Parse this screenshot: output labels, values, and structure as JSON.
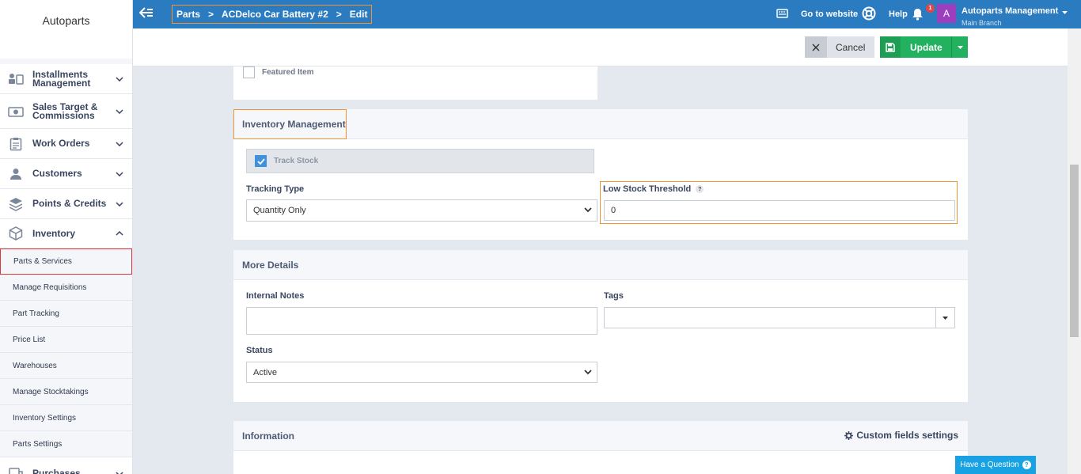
{
  "app": {
    "brand": "Autoparts"
  },
  "breadcrumb": [
    "Parts",
    "ACDelco Car Battery #2",
    "Edit"
  ],
  "topbar": {
    "go_to_website": "Go to website",
    "help": "Help",
    "notification_count": "1",
    "avatar_letter": "A",
    "account_name": "Autoparts Management",
    "account_branch": "Main Branch"
  },
  "actions": {
    "cancel": "Cancel",
    "update": "Update"
  },
  "sidebar": {
    "items": [
      {
        "label": "Installments Management",
        "icon": "installments-icon"
      },
      {
        "label": "Sales Target & Commissions",
        "icon": "commissions-icon"
      },
      {
        "label": "Work Orders",
        "icon": "clipboard-icon"
      },
      {
        "label": "Customers",
        "icon": "user-icon"
      },
      {
        "label": "Points & Credits",
        "icon": "layers-icon"
      },
      {
        "label": "Inventory",
        "icon": "box-icon"
      },
      {
        "label": "Purchases",
        "icon": "purchases-icon"
      }
    ],
    "inventory_sub": [
      "Parts & Services",
      "Manage Requisitions",
      "Part Tracking",
      "Price List",
      "Warehouses",
      "Manage Stocktakings",
      "Inventory Settings",
      "Parts Settings"
    ]
  },
  "featured": {
    "label": "Featured Item",
    "checked": false
  },
  "inventory": {
    "title": "Inventory Management",
    "track_stock_label": "Track Stock",
    "track_stock_checked": true,
    "tracking_type_label": "Tracking Type",
    "tracking_type_value": "Quantity Only",
    "low_stock_label": "Low Stock Threshold",
    "low_stock_value": "0"
  },
  "more_details": {
    "title": "More Details",
    "internal_notes_label": "Internal Notes",
    "internal_notes_value": "",
    "tags_label": "Tags",
    "status_label": "Status",
    "status_value": "Active"
  },
  "information": {
    "title": "Information",
    "custom_fields_link": "Custom fields settings"
  },
  "help_widget": {
    "label": "Have a Question"
  },
  "colors": {
    "topbar": "#2a7bc0",
    "update": "#21b15f",
    "highlight": "#f29433",
    "active_border": "#d9363e"
  }
}
